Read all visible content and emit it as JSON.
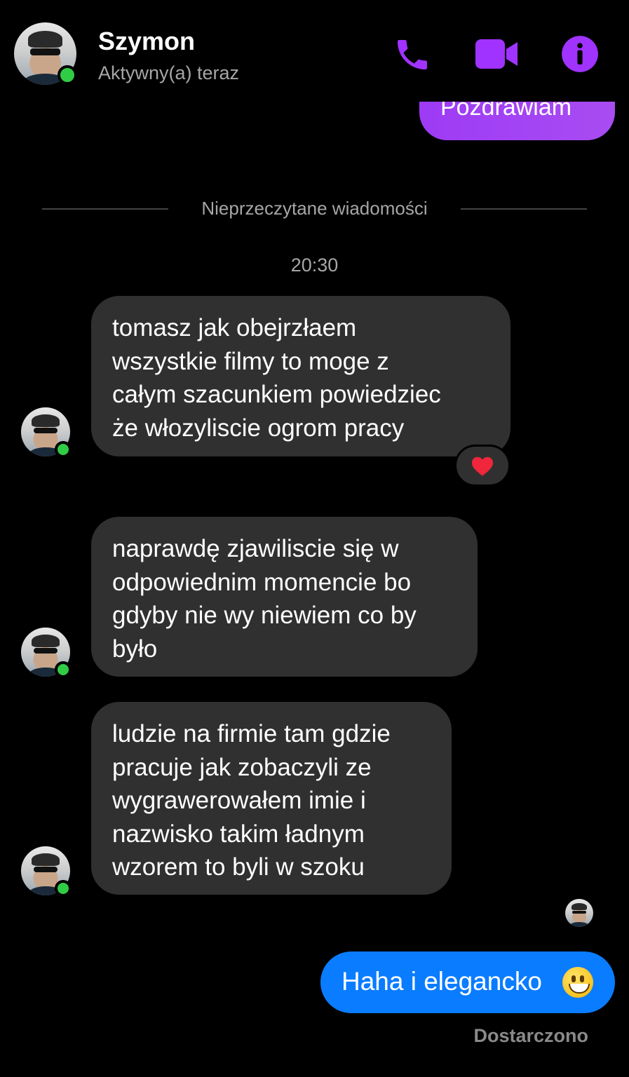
{
  "header": {
    "name": "Szymon",
    "status": "Aktywny(a) teraz",
    "icons": [
      "phone-icon",
      "video-camera-icon",
      "info-icon"
    ],
    "accent_color": "#a033ff"
  },
  "previous_message": {
    "text": "Pozdrawiam",
    "color": "#a94cf2"
  },
  "divider": {
    "label": "Nieprzeczytane wiadomości"
  },
  "timestamp": "20:30",
  "messages": [
    {
      "lines": [
        "tomasz jak obejrzłaem",
        "wszystkie filmy to moge z",
        "całym szacunkiem powiedziec",
        "że włozyliscie ogrom pracy"
      ],
      "reaction": "heart"
    },
    {
      "lines": [
        "naprawdę zjawiliscie się w",
        "odpowiednim momencie bo",
        "gdyby nie wy niewiem co by",
        "było"
      ]
    },
    {
      "lines": [
        "ludzie na firmie tam gdzie",
        "pracuje jak zobaczyli ze",
        "wygrawerowałem imie i",
        "nazwisko takim ładnym",
        "wzorem to byli w szoku"
      ]
    }
  ],
  "sent_message": {
    "text": "Haha i elegancko",
    "emoji": "grinning-face",
    "color": "#0a7cff"
  },
  "delivery_status": "Dostarczono"
}
